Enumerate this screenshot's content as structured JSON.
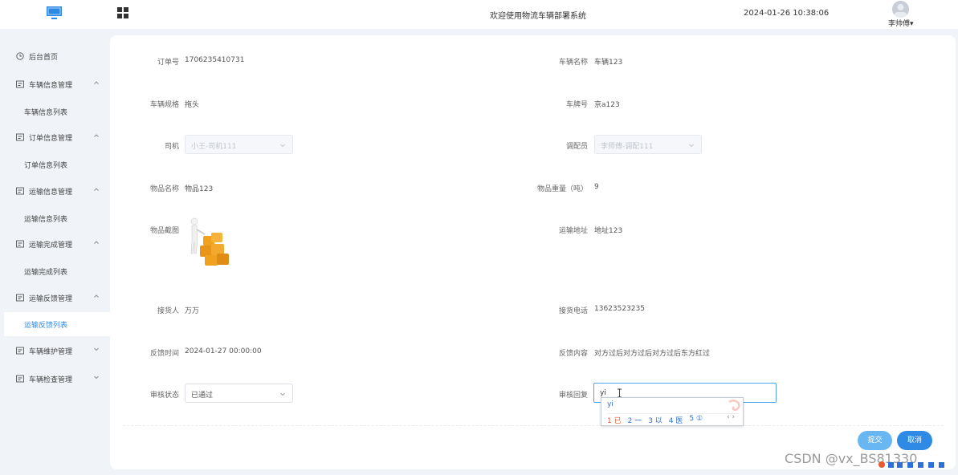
{
  "header": {
    "title": "欢迎使用物流车辆部署系统",
    "datetime": "2024-01-26 10:38:06",
    "user_name": "李帅傅",
    "user_caret": "▾"
  },
  "sidebar": {
    "home": "后台首页",
    "groups": [
      {
        "label": "车辆信息管理",
        "sub": "车辆信息列表"
      },
      {
        "label": "订单信息管理",
        "sub": "订单信息列表"
      },
      {
        "label": "运输信息管理",
        "sub": "运输信息列表"
      },
      {
        "label": "运输完成管理",
        "sub": "运输完成列表"
      },
      {
        "label": "运输反馈管理",
        "sub": "运输反馈列表"
      }
    ],
    "collapsed": [
      {
        "label": "车辆维护管理"
      },
      {
        "label": "车辆检查管理"
      }
    ]
  },
  "form": {
    "order_no": {
      "label": "订单号",
      "value": "1706235410731"
    },
    "vehicle_name": {
      "label": "车辆名称",
      "value": "车辆123"
    },
    "vehicle_spec": {
      "label": "车辆规格",
      "value": "拖头"
    },
    "plate_no": {
      "label": "车牌号",
      "value": "京a123"
    },
    "driver": {
      "label": "司机",
      "value": "小王-司机111"
    },
    "dispatcher": {
      "label": "调配员",
      "value": "李师傅-调配111"
    },
    "goods_name": {
      "label": "物品名称",
      "value": "物品123"
    },
    "goods_weight": {
      "label": "物品重量（吨）",
      "value": "9"
    },
    "goods_image": {
      "label": "物品截图"
    },
    "address": {
      "label": "运输地址",
      "value": "地址123"
    },
    "receiver": {
      "label": "接货人",
      "value": "万万"
    },
    "receiver_phone": {
      "label": "接货电话",
      "value": "13623523235"
    },
    "feedback_time": {
      "label": "反馈时间",
      "value": "2024-01-27 00:00:00"
    },
    "feedback_content": {
      "label": "反馈内容",
      "value": "对方过后对方过后对方过后东方红过"
    },
    "review_status": {
      "label": "审核状态",
      "value": "已通过"
    },
    "review_reply": {
      "label": "审核回复",
      "value": "yi"
    }
  },
  "buttons": {
    "submit": "提交",
    "cancel": "取消"
  },
  "ime": {
    "composition": "yi",
    "candidates": [
      "1 已",
      "2 一",
      "3 以",
      "4 医",
      "5 ①"
    ],
    "nav": "‹ ›"
  },
  "watermark": "CSDN @vx_BS81330",
  "colors": {
    "accent": "#2f8ae6",
    "submit_button": "#69b7f2",
    "sidebar_bg": "#f0f3f8"
  }
}
